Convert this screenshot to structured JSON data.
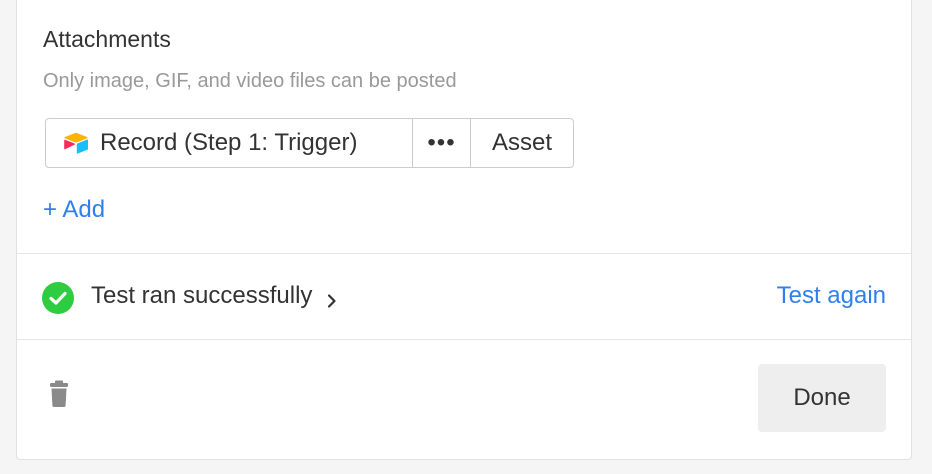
{
  "attachments": {
    "title": "Attachments",
    "help_text": "Only image, GIF, and video files can be posted",
    "token": {
      "app_icon": "airtable-logo-icon",
      "record_label": "Record (Step 1: Trigger)",
      "more_label": "•••",
      "field_label": "Asset"
    },
    "add_label": "+ Add"
  },
  "test": {
    "status_icon": "check-circle-icon",
    "status_color": "#2ecc40",
    "status_text": "Test ran successfully",
    "again_label": "Test again"
  },
  "footer": {
    "trash_icon": "trash-icon",
    "done_label": "Done"
  },
  "colors": {
    "link": "#2f80ed",
    "text": "#333333",
    "muted": "#999999",
    "success": "#2ecc40"
  }
}
